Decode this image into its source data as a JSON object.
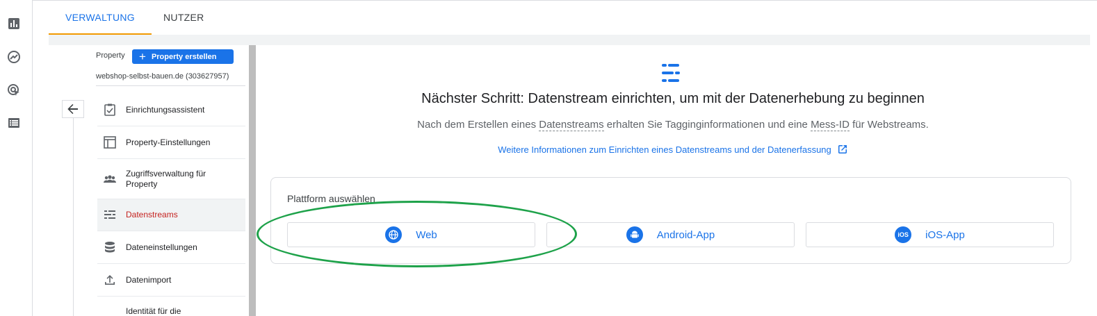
{
  "tabs": [
    {
      "label": "VERWALTUNG",
      "active": true
    },
    {
      "label": "NUTZER",
      "active": false
    }
  ],
  "rail": [
    "bar-chart-icon",
    "explore-icon",
    "advertising-icon",
    "configure-icon"
  ],
  "property": {
    "label": "Property",
    "create_label": "Property erstellen",
    "name": "webshop-selbst-bauen.de (303627957)"
  },
  "nav": [
    {
      "label": "Einrichtungsassistent",
      "icon": "checklist-icon"
    },
    {
      "label": "Property-Einstellungen",
      "icon": "window-icon"
    },
    {
      "label": "Zugriffsverwaltung für Property",
      "icon": "people-icon"
    },
    {
      "label": "Datenstreams",
      "icon": "data-streams-icon",
      "active": true
    },
    {
      "label": "Dateneinstellungen",
      "icon": "database-icon"
    },
    {
      "label": "Datenimport",
      "icon": "upload-icon"
    },
    {
      "label": "Identität für die",
      "icon": "identity-icon"
    }
  ],
  "main": {
    "headline": "Nächster Schritt: Datenstream einrichten, um mit der Datenerhebung zu beginnen",
    "sub_pre": "Nach dem Erstellen eines ",
    "sub_term1": "Datenstreams",
    "sub_mid": " erhalten Sie Tagginginformationen und eine ",
    "sub_term2": "Mess-ID",
    "sub_post": " für Webstreams.",
    "link": "Weitere Informationen zum Einrichten eines Datenstreams und der Datenerfassung",
    "platform_title": "Plattform auswählen",
    "platforms": [
      {
        "label": "Web",
        "icon": "globe-icon"
      },
      {
        "label": "Android-App",
        "icon": "android-icon"
      },
      {
        "label": "iOS-App",
        "icon": "ios-icon",
        "badge": "iOS"
      }
    ]
  },
  "colors": {
    "accent": "#1a73e8",
    "tab_indicator": "#f29900",
    "active_nav": "#c5221f",
    "highlight": "#1ea24a"
  }
}
